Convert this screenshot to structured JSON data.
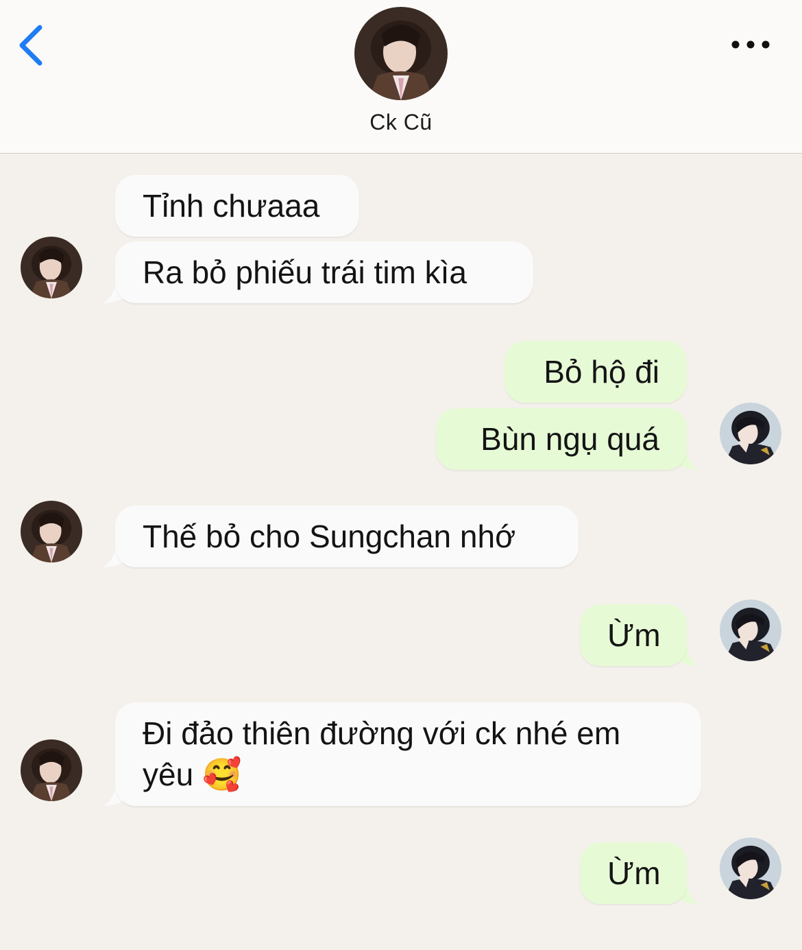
{
  "header": {
    "contact_name": "Ck Cũ",
    "back_icon": "chevron-left-icon",
    "more_icon": "more-horizontal-icon",
    "accent_color": "#1f7cf5"
  },
  "colors": {
    "background": "#f4f1ec",
    "incoming_bubble": "#fafafa",
    "outgoing_bubble": "#e7fad6"
  },
  "messages": [
    {
      "sender": "contact",
      "text": "Tỉnh chưaaa"
    },
    {
      "sender": "contact",
      "text": "Ra bỏ phiếu trái tim kìa"
    },
    {
      "sender": "me",
      "text": "Bỏ hộ đi"
    },
    {
      "sender": "me",
      "text": "Bùn ngụ quá"
    },
    {
      "sender": "contact",
      "text": "Thế bỏ cho Sungchan nhớ"
    },
    {
      "sender": "me",
      "text": "Ừm"
    },
    {
      "sender": "contact",
      "text": "Đi đảo thiên đường với ck nhé em yêu 🥰"
    },
    {
      "sender": "me",
      "text": "Ừm"
    }
  ]
}
